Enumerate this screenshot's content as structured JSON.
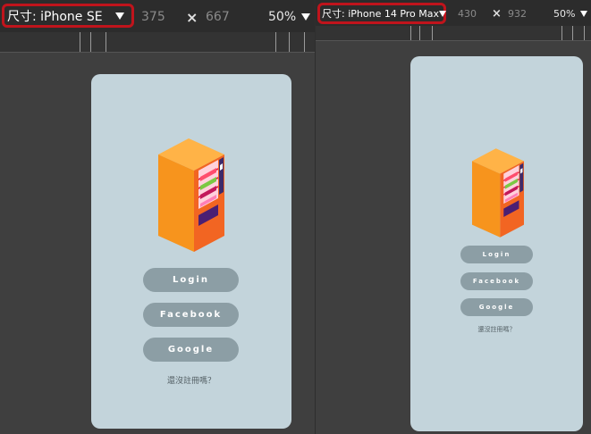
{
  "left": {
    "toolbar": {
      "device_label": "尺寸: iPhone SE",
      "width": "375",
      "times": "×",
      "height": "667",
      "zoom": "50%"
    },
    "app": {
      "login": "Login",
      "facebook": "Facebook",
      "google": "Google",
      "register": "還沒註冊嗎？"
    }
  },
  "right": {
    "toolbar": {
      "device_label": "尺寸: iPhone 14 Pro Max",
      "width": "430",
      "times": "×",
      "height": "932",
      "zoom": "50%"
    },
    "app": {
      "login": "Login",
      "facebook": "Facebook",
      "google": "Google",
      "register": "還沒註冊嗎？"
    }
  },
  "colors": {
    "highlight_border": "#c0141c",
    "phone_bg": "#c3d4db",
    "button_bg": "#8c9ea5",
    "machine_orange": "#f7941d"
  },
  "icons": [
    "dropdown-triangle-icon",
    "vending-machine-illustration"
  ]
}
